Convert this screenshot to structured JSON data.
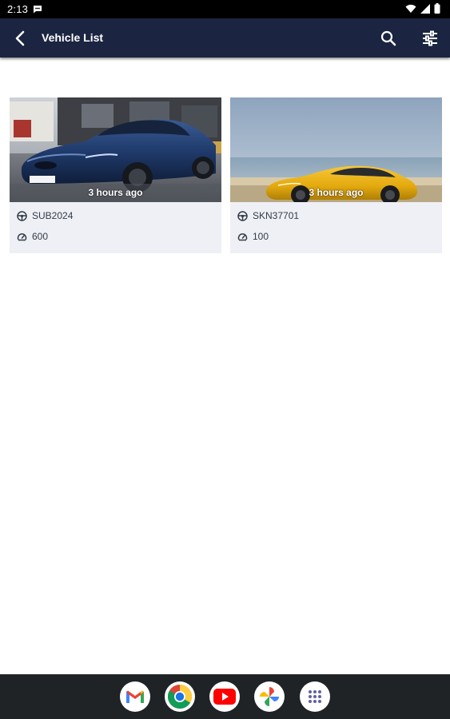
{
  "status_bar": {
    "time": "2:13",
    "icons": [
      "chat-notification-icon",
      "wifi-icon",
      "signal-icon",
      "battery-icon"
    ]
  },
  "app_bar": {
    "title": "Vehicle List",
    "background_color": "#1b2541",
    "icons": [
      "back-arrow-icon",
      "search-icon",
      "filter-sliders-icon"
    ]
  },
  "vehicles": [
    {
      "image": "blue-sports-car-photo",
      "time_ago": "3 hours ago",
      "plate": "SUB2024",
      "mileage": "600"
    },
    {
      "image": "yellow-sports-car-photo",
      "time_ago": "3 hours ago",
      "plate": "SKN37701",
      "mileage": "100"
    }
  ],
  "dock": {
    "apps": [
      "gmail-icon",
      "chrome-icon",
      "youtube-icon",
      "photos-icon",
      "app-drawer-icon"
    ]
  }
}
